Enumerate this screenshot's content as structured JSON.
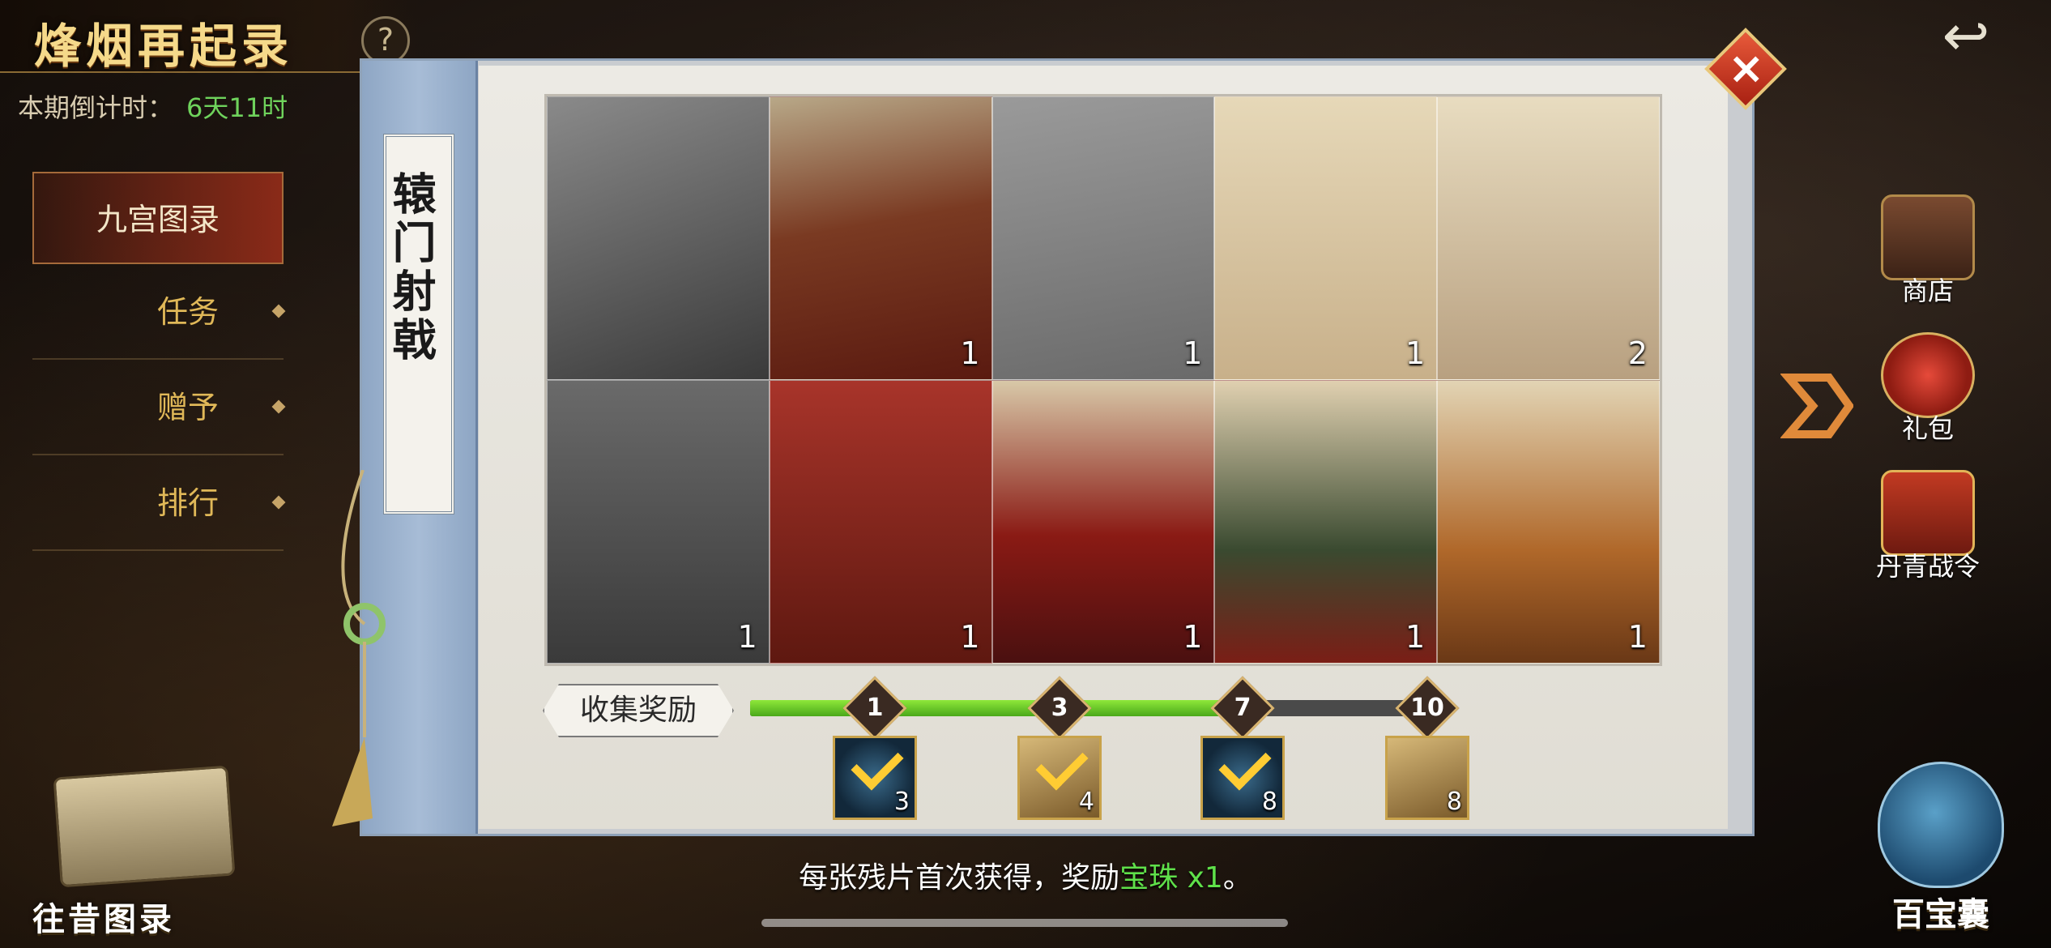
{
  "header": {
    "title": "烽烟再起录",
    "help": "?",
    "back_icon": "back-arrow-icon"
  },
  "countdown": {
    "label": "本期倒计时：",
    "value": "6天11时"
  },
  "side_nav": {
    "items": [
      {
        "label": "九宫图录",
        "active": true
      },
      {
        "label": "任务",
        "active": false
      },
      {
        "label": "赠予",
        "active": false
      },
      {
        "label": "排行",
        "active": false
      }
    ]
  },
  "panel": {
    "title": "辕门射戟",
    "close": "×",
    "tiles": [
      {
        "locked": true,
        "count": ""
      },
      {
        "locked": false,
        "count": "1"
      },
      {
        "locked": true,
        "count": "1"
      },
      {
        "locked": false,
        "count": "1"
      },
      {
        "locked": false,
        "count": "2"
      },
      {
        "locked": true,
        "count": "1"
      },
      {
        "locked": false,
        "count": "1"
      },
      {
        "locked": false,
        "count": "1"
      },
      {
        "locked": false,
        "count": "1"
      },
      {
        "locked": false,
        "count": "1"
      }
    ],
    "rewards_label": "收集奖励",
    "progress_fraction": 0.71,
    "milestones": [
      {
        "num": "1",
        "qty": "3",
        "icon": "orb-check-icon"
      },
      {
        "num": "3",
        "qty": "4",
        "icon": "scroll-check-icon"
      },
      {
        "num": "7",
        "qty": "8",
        "icon": "orb-check-icon"
      },
      {
        "num": "10",
        "qty": "8",
        "icon": "scroll-icon"
      }
    ]
  },
  "right_menu": {
    "items": [
      {
        "label": "商店",
        "icon": "chest-icon"
      },
      {
        "label": "礼包",
        "icon": "gift-bag-icon"
      },
      {
        "label": "丹青战令",
        "icon": "order-token-icon"
      }
    ]
  },
  "bottom": {
    "past_label": "往昔图录",
    "bag_label": "百宝囊",
    "note_prefix": "每张残片首次获得，奖励",
    "note_item": "宝珠 x1",
    "note_suffix": "。"
  },
  "colors": {
    "accent_green": "#5fe04a",
    "gold": "#e0b858",
    "panel_blue": "#8ea6c4"
  }
}
